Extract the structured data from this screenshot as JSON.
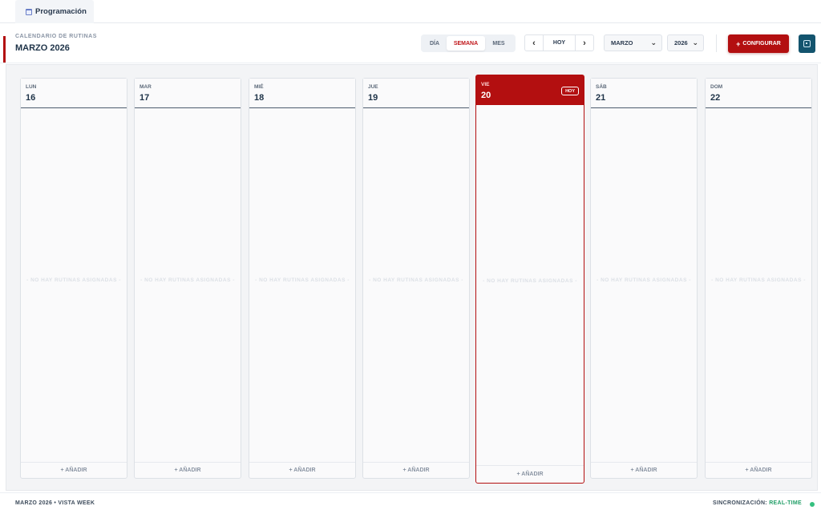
{
  "tab": {
    "label": "Programación"
  },
  "header": {
    "subtitle": "CALENDARIO DE RUTINAS",
    "title": "MARZO 2026"
  },
  "view_modes": {
    "day": "DÍA",
    "week": "SEMANA",
    "month": "MES",
    "active": "SEMANA"
  },
  "nav": {
    "prev": "‹",
    "today": "HOY",
    "next": "›"
  },
  "selects": {
    "month": "MARZO",
    "year": "2026"
  },
  "actions": {
    "configure": "CONFIGURAR",
    "configure_plus": "+"
  },
  "days": [
    {
      "dow": "LUN",
      "num": "16",
      "empty": "- NO HAY RUTINAS ASIGNADAS -",
      "add": "+ AÑADIR"
    },
    {
      "dow": "MAR",
      "num": "17",
      "empty": "- NO HAY RUTINAS ASIGNADAS -",
      "add": "+ AÑADIR"
    },
    {
      "dow": "MIÉ",
      "num": "18",
      "empty": "- NO HAY RUTINAS ASIGNADAS -",
      "add": "+ AÑADIR"
    },
    {
      "dow": "JUE",
      "num": "19",
      "empty": "- NO HAY RUTINAS ASIGNADAS -",
      "add": "+ AÑADIR"
    },
    {
      "dow": "VIE",
      "num": "20",
      "empty": "- NO HAY RUTINAS ASIGNADAS -",
      "add": "+ AÑADIR",
      "badge": "HOY"
    },
    {
      "dow": "SÁB",
      "num": "21",
      "empty": "- NO HAY RUTINAS ASIGNADAS -",
      "add": "+ AÑADIR"
    },
    {
      "dow": "DOM",
      "num": "22",
      "empty": "- NO HAY RUTINAS ASIGNADAS -",
      "add": "+ AÑADIR"
    }
  ],
  "footer": {
    "left": "MARZO 2026 • VISTA WEEK",
    "sync_label": "SINCRONIZACIÓN:",
    "sync_value": "REAL-TIME"
  },
  "colors": {
    "accent": "#b30f10",
    "sync": "#13546e",
    "live": "#35c07f"
  }
}
